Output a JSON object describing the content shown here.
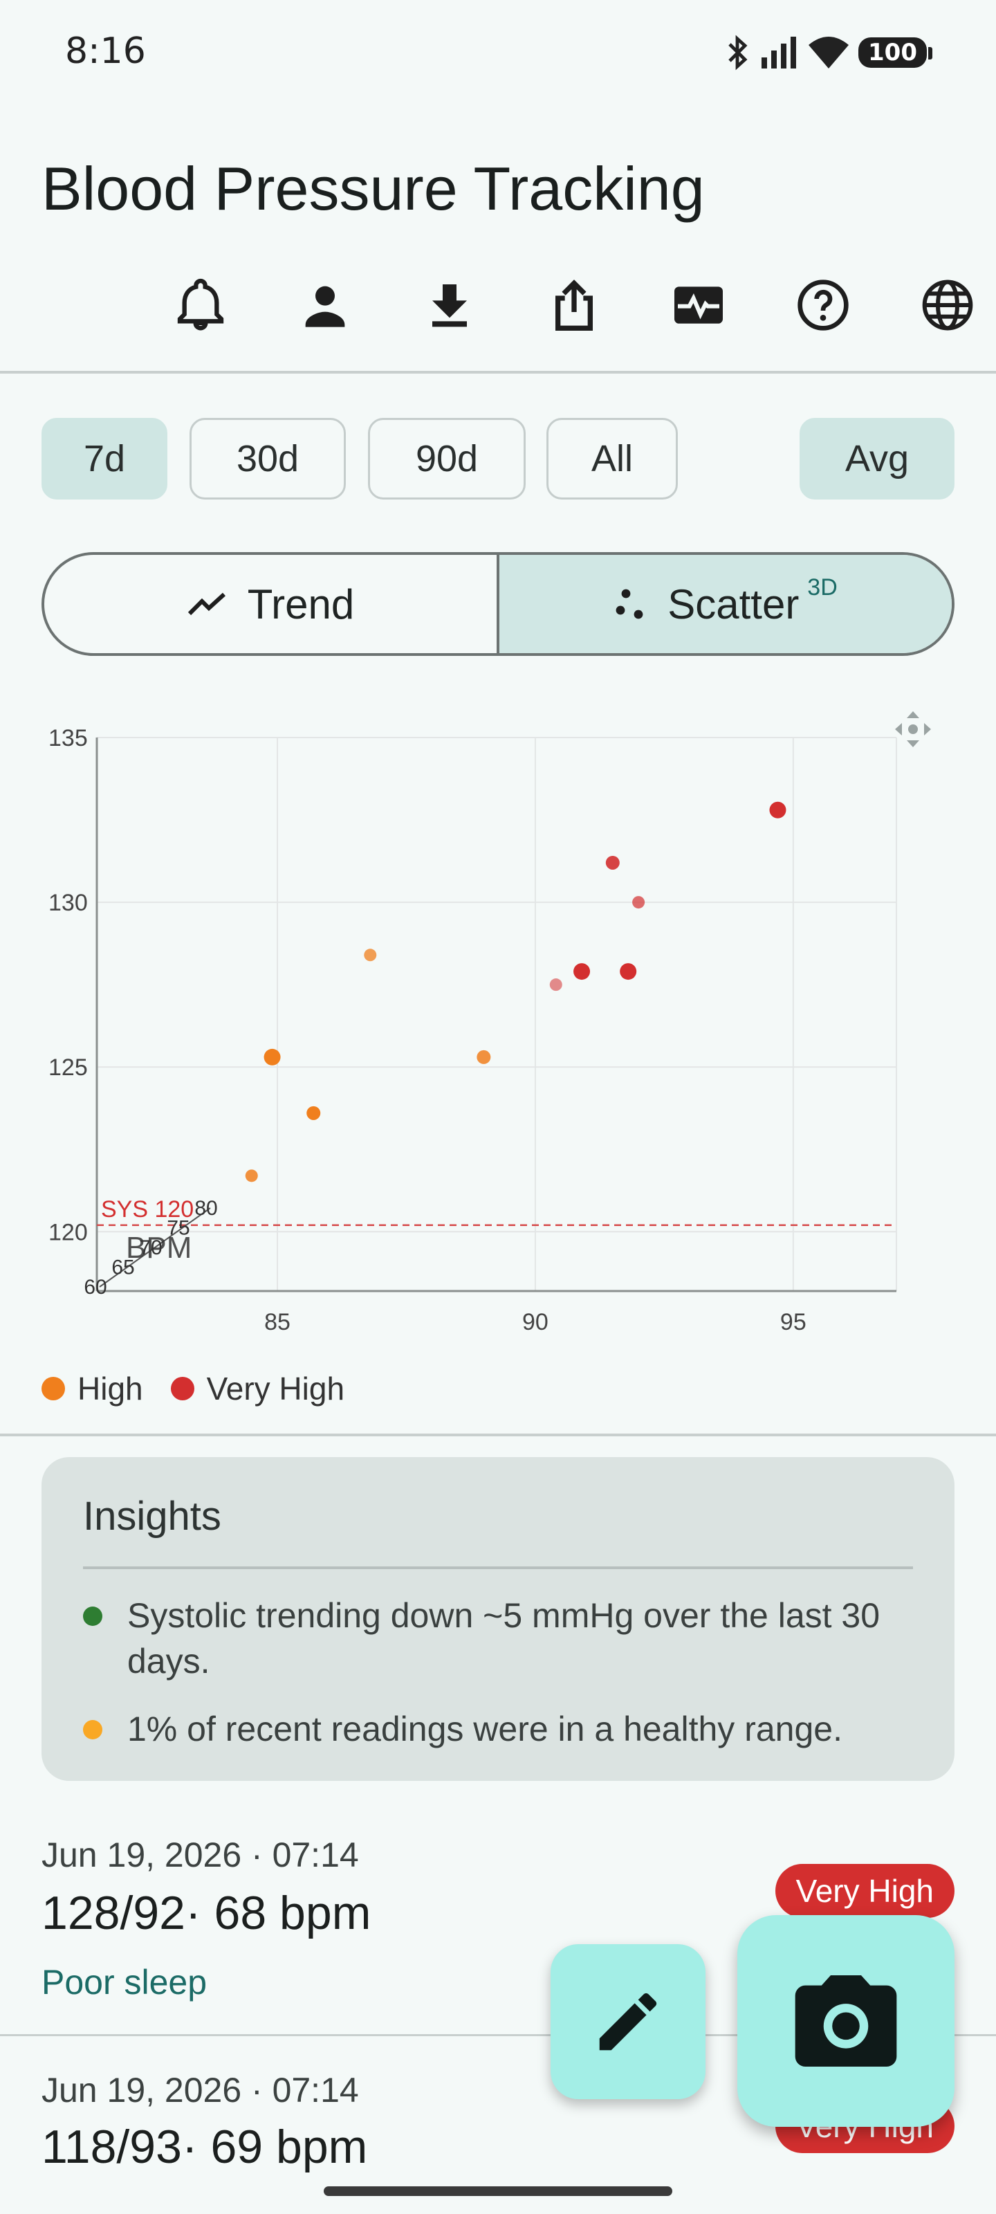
{
  "status": {
    "time": "8:16",
    "battery": "100"
  },
  "header": {
    "title": "Blood Pressure Tracking"
  },
  "toolbar_icons": [
    "bell-icon",
    "person-icon",
    "download-icon",
    "share-icon",
    "heart-monitor-icon",
    "help-icon",
    "globe-icon"
  ],
  "ranges": {
    "d7": "7d",
    "d30": "30d",
    "d90": "90d",
    "all": "All",
    "avg": "Avg",
    "selected": "7d"
  },
  "view_toggle": {
    "trend": "Trend",
    "scatter": "Scatter",
    "scatter_badge": "3D",
    "selected": "Scatter"
  },
  "chart_data": {
    "type": "scatter",
    "xlabel": "",
    "ylabel": "",
    "xlim": [
      81.5,
      97
    ],
    "ylim": [
      118.2,
      135
    ],
    "x_ticks": [
      "85",
      "90",
      "95"
    ],
    "y_ticks": [
      "120",
      "125",
      "130",
      "135"
    ],
    "reference_line": {
      "y": 120.2,
      "label": "SYS 120"
    },
    "z_axis": {
      "label": "BPM",
      "ticks": [
        "60",
        "65",
        "70",
        "75",
        "80"
      ]
    },
    "series": [
      {
        "name": "High",
        "color": "#f07f1d",
        "points": [
          [
            84.9,
            125.3
          ],
          [
            85.7,
            123.6
          ],
          [
            84.5,
            121.7
          ],
          [
            86.8,
            128.4
          ],
          [
            89.0,
            125.3
          ]
        ]
      },
      {
        "name": "Very High",
        "color": "#d32f2f",
        "points": [
          [
            94.7,
            132.8
          ],
          [
            91.5,
            131.2
          ],
          [
            92.0,
            130.0
          ],
          [
            90.9,
            127.9
          ],
          [
            91.8,
            127.9
          ],
          [
            90.4,
            127.5
          ]
        ]
      }
    ],
    "legend": [
      "High",
      "Very High"
    ],
    "grid": true
  },
  "insights": {
    "title": "Insights",
    "items": [
      {
        "text": "Systolic trending down ~5 mmHg over the last 30 days.",
        "color": "#2e7d32"
      },
      {
        "text": "1% of recent readings were in a healthy range.",
        "color": "#f9a825"
      }
    ]
  },
  "readings": [
    {
      "date": "Jun 19, 2026 · 07:14",
      "value": "128/92· 68 bpm",
      "note": "Poor sleep",
      "badge": "Very High"
    },
    {
      "date": "Jun 19, 2026 · 07:14",
      "value": "118/93· 69 bpm",
      "note": "",
      "badge": "Very High"
    }
  ]
}
